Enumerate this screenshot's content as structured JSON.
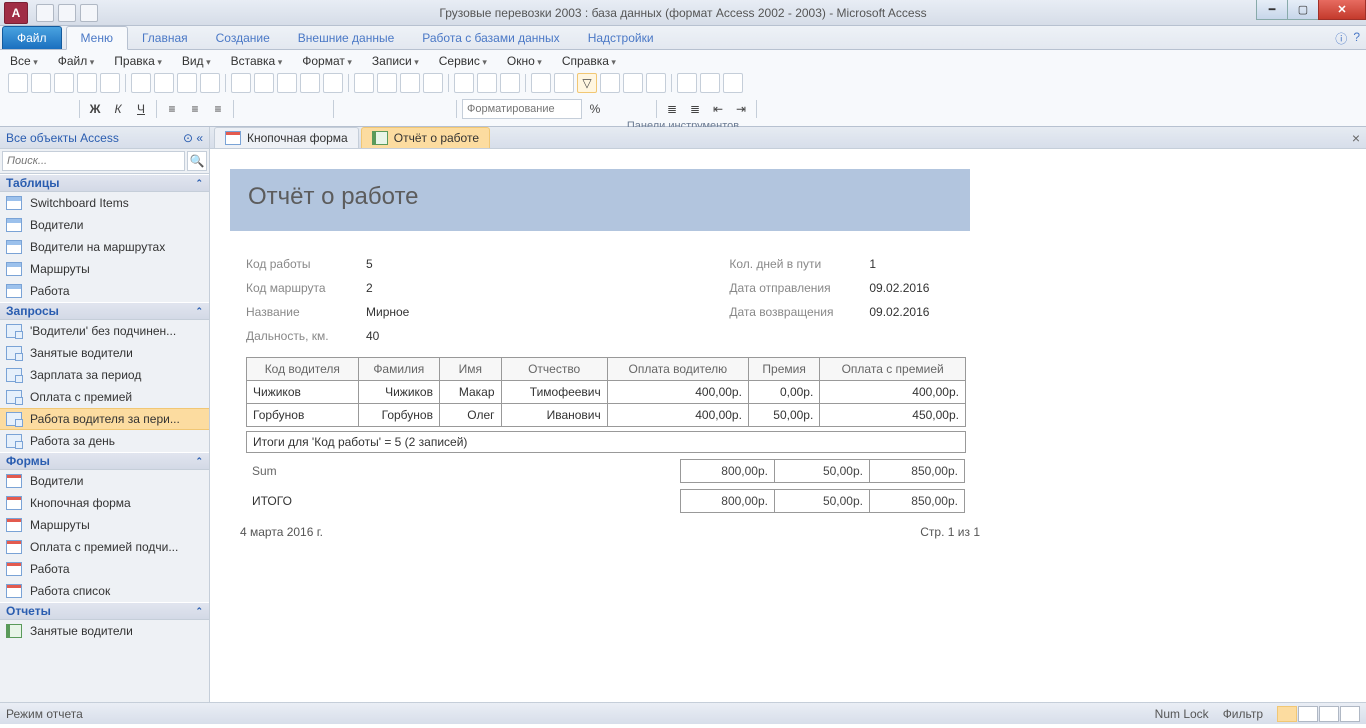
{
  "window": {
    "app_letter": "A",
    "title": "Грузовые перевозки 2003 : база данных (формат Access 2002 - 2003)  -  Microsoft Access"
  },
  "ribbon": {
    "file": "Файл",
    "tabs": [
      "Меню",
      "Главная",
      "Создание",
      "Внешние данные",
      "Работа с базами данных",
      "Надстройки"
    ],
    "menus": [
      "Все",
      "Файл",
      "Правка",
      "Вид",
      "Вставка",
      "Формат",
      "Записи",
      "Сервис",
      "Окно",
      "Справка"
    ],
    "format_placeholder": "Форматирование",
    "caption": "Панели инструментов"
  },
  "nav": {
    "title": "Все объекты Access",
    "search_placeholder": "Поиск...",
    "groups": {
      "tables": {
        "label": "Таблицы",
        "items": [
          "Switchboard Items",
          "Водители",
          "Водители на маршрутах",
          "Маршруты",
          "Работа"
        ]
      },
      "queries": {
        "label": "Запросы",
        "items": [
          "'Водители' без подчинен...",
          "Занятые водители",
          "Зарплата за период",
          "Оплата с премией",
          "Работа водителя за пери...",
          "Работа за день"
        ]
      },
      "forms": {
        "label": "Формы",
        "items": [
          "Водители",
          "Кнопочная форма",
          "Маршруты",
          "Оплата с премией подчи...",
          "Работа",
          "Работа список"
        ]
      },
      "reports": {
        "label": "Отчеты",
        "items": [
          "Занятые водители"
        ]
      }
    },
    "selected": "Работа водителя за пери..."
  },
  "doctabs": {
    "t1": "Кнопочная форма",
    "t2": "Отчёт о работе"
  },
  "report": {
    "title": "Отчёт о работе",
    "left": [
      {
        "label": "Код работы",
        "value": "5"
      },
      {
        "label": "Код маршрута",
        "value": "2"
      },
      {
        "label": "Название",
        "value": "Мирное"
      },
      {
        "label": "Дальность, км.",
        "value": "40"
      }
    ],
    "right": [
      {
        "label": "Кол. дней в пути",
        "value": "1"
      },
      {
        "label": "Дата отправления",
        "value": "09.02.2016"
      },
      {
        "label": "Дата возвращения",
        "value": "09.02.2016"
      }
    ],
    "columns": [
      "Код водителя",
      "Фамилия",
      "Имя",
      "Отчество",
      "Оплата водителю",
      "Премия",
      "Оплата с премией"
    ],
    "rows": [
      {
        "c": [
          "Чижиков",
          "Чижиков",
          "Макар",
          "Тимофеевич",
          "400,00р.",
          "0,00р.",
          "400,00р."
        ]
      },
      {
        "c": [
          "Горбунов",
          "Горбунов",
          "Олег",
          "Иванович",
          "400,00р.",
          "50,00р.",
          "450,00р."
        ]
      }
    ],
    "group_footer": "Итоги для 'Код работы' =  5 (2 записей)",
    "sum_label": "Sum",
    "sum": [
      "800,00р.",
      "50,00р.",
      "850,00р."
    ],
    "grand_label": "ИТОГО",
    "grand": [
      "800,00р.",
      "50,00р.",
      "850,00р."
    ],
    "date": "4 марта 2016 г.",
    "page": "Стр. 1 из 1"
  },
  "status": {
    "left": "Режим отчета",
    "numlock": "Num Lock",
    "filter": "Фильтр"
  }
}
